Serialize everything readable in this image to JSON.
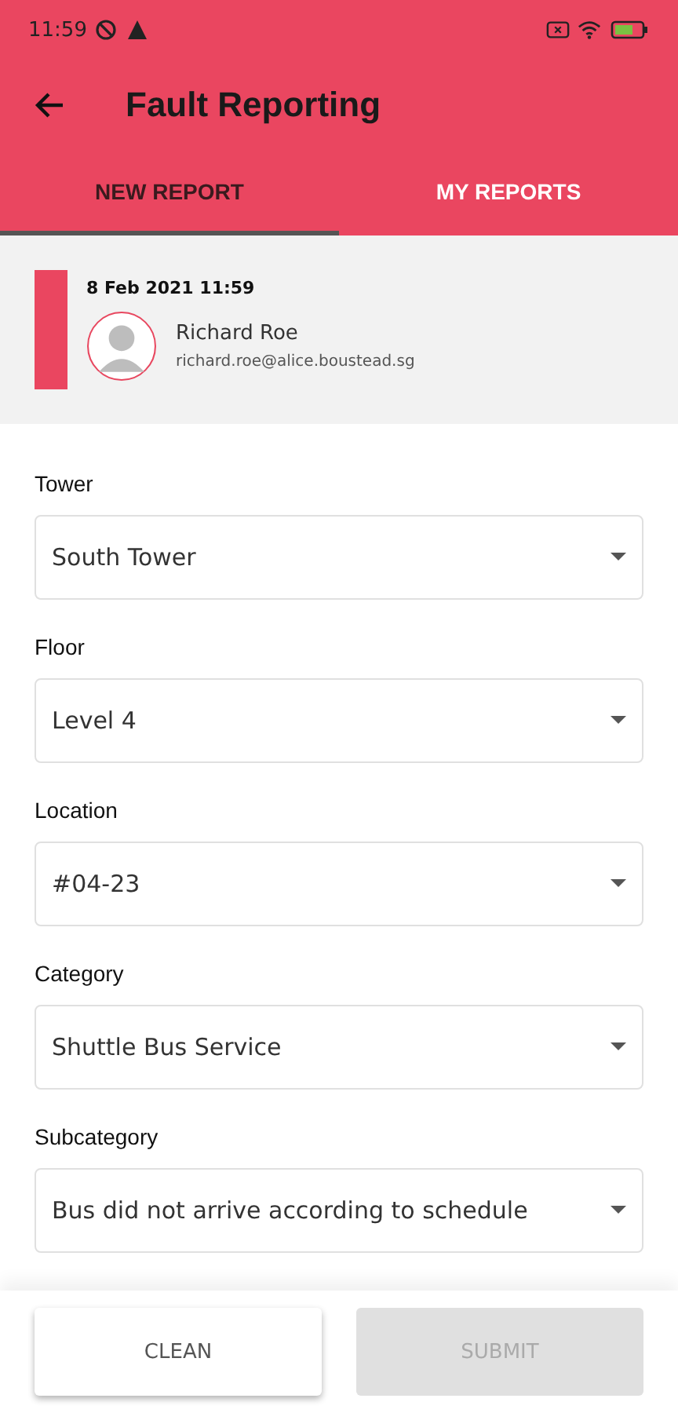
{
  "status_bar": {
    "time": "11:59"
  },
  "app_bar": {
    "title": "Fault Reporting"
  },
  "tabs": [
    {
      "label": "NEW REPORT",
      "selected": true
    },
    {
      "label": "MY REPORTS",
      "selected": false
    }
  ],
  "reporter": {
    "date": "8 Feb 2021 11:59",
    "name": "Richard Roe",
    "email": "richard.roe@alice.boustead.sg"
  },
  "fields": [
    {
      "label": "Tower",
      "value": "South Tower"
    },
    {
      "label": "Floor",
      "value": "Level 4"
    },
    {
      "label": "Location",
      "value": "#04-23"
    },
    {
      "label": "Category",
      "value": "Shuttle Bus Service"
    },
    {
      "label": "Subcategory",
      "value": "Bus did not arrive according to schedule"
    }
  ],
  "buttons": [
    {
      "label": "CLEAN",
      "disabled": false
    },
    {
      "label": "SUBMIT",
      "disabled": true
    }
  ]
}
